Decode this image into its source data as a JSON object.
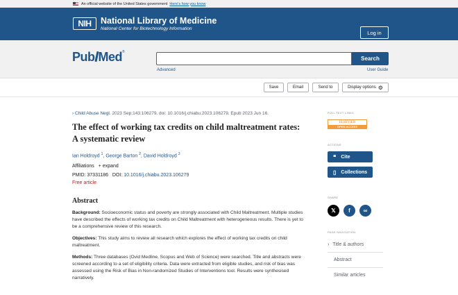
{
  "gov_banner": {
    "text": "An official website of the United States government",
    "link": "Here's how you know"
  },
  "header": {
    "logo": "NIH",
    "title": "National Library of Medicine",
    "subtitle": "National Center for Biotechnology Information",
    "login": "Log in"
  },
  "search": {
    "logo_left": "Pub",
    "logo_right": "Med",
    "logo_mark": "®",
    "value": "",
    "button": "Search",
    "advanced": "Advanced",
    "guide": "User Guide"
  },
  "toolbar": {
    "save": "Save",
    "email": "Email",
    "send_to": "Send to",
    "display": "Display options"
  },
  "article": {
    "journal": "Child Abuse Negl.",
    "citation_rest": " 2023 Sep;143:106279. doi: 10.1016/j.chiabu.2023.106279. Epub 2023 Jun 16.",
    "title": "The effect of working tax credits on child maltreatment rates: A systematic review",
    "authors": [
      {
        "name": "Ian Holdroyd",
        "sup": "1"
      },
      {
        "name": "George Barton",
        "sup": "2"
      },
      {
        "name": "David Holdroyd",
        "sup": "3"
      }
    ],
    "affiliations": "Affiliations",
    "expand": "+ expand",
    "pmid": "PMID: 37331186",
    "doi_label": "DOI: ",
    "doi": "10.1016/j.chiabu.2023.106279",
    "free": "Free article",
    "abstract_heading": "Abstract",
    "sections": [
      {
        "label": "Background:",
        "text": " Socioeconomic status and poverty are strongly associated with Child Maltreatment. Multiple studies have described the effects of working tax credits on Child Maltreatment with heterogeneous results. There is yet to be a comprehensive review of this research."
      },
      {
        "label": "Objectives:",
        "text": " This study aims to review all research which explores the effect of working tax credits on child maltreatment."
      },
      {
        "label": "Methods:",
        "text": " Three databases (Ovid Medline, Scopus and Web of Science) were searched. Title and abstracts were screened according to a set of eligibility criteria. Data were extracted from eligible studies, and risk of bias was assessed using the Risk of Bias in Non-randomized Studies of Interventions tool. Results were synthesised narratively."
      }
    ]
  },
  "sidebar": {
    "full_text_label": "FULL TEXT LINKS",
    "publisher": "ELSEVIER",
    "open_access": "OPEN ACCESS",
    "actions_label": "ACTIONS",
    "cite": "Cite",
    "collections": "Collections",
    "share_label": "SHARE",
    "nav_label": "PAGE NAVIGATION",
    "nav": [
      "Title & authors",
      "Abstract",
      "Similar articles"
    ]
  },
  "colors": {
    "brand": "#20558a",
    "free": "#bb1f1f",
    "twitter": "#000000",
    "facebook": "#1877f2",
    "link": "#20558a"
  }
}
